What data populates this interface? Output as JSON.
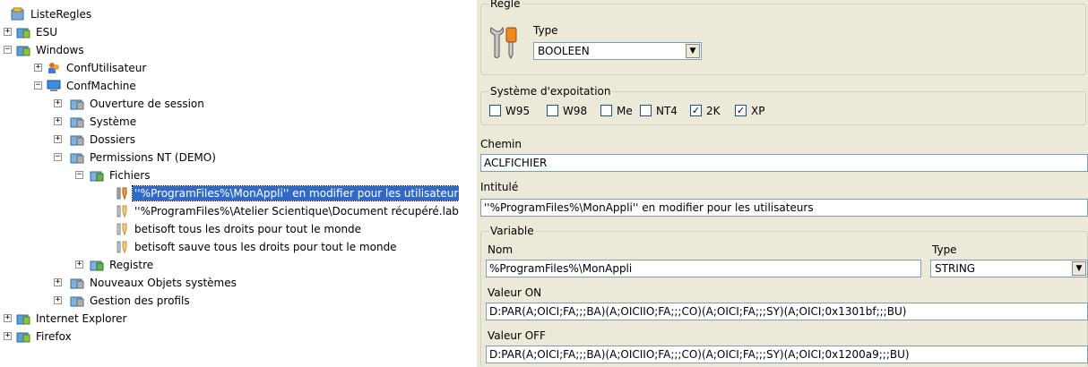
{
  "tree": {
    "root": "ListeRegles",
    "esu": "ESU",
    "windows": "Windows",
    "conf_utilisateur": "ConfUtilisateur",
    "conf_machine": "ConfMachine",
    "ouverture": "Ouverture de session",
    "systeme": "Système",
    "dossiers": "Dossiers",
    "permissions": "Permissions NT (DEMO)",
    "fichiers": "Fichiers",
    "rule1": "''%ProgramFiles%\\MonAppli'' en modifier pour les utilisateurs",
    "rule2": "''%ProgramFiles%\\Atelier Scientique\\Document récupéré.lab'' to",
    "rule3": "betisoft tous les droits pour tout le monde",
    "rule4": "betisoft sauve tous les droits pour tout le monde",
    "registre": "Registre",
    "nouveaux": "Nouveaux Objets systèmes",
    "gestion": "Gestion des profils",
    "ie": "Internet Explorer",
    "firefox": "Firefox"
  },
  "regle": {
    "legend": "Règle",
    "type_label": "Type",
    "type_value": "BOOLEEN"
  },
  "os": {
    "legend": "Système d'expoitation",
    "options": [
      {
        "label": "W95",
        "checked": false
      },
      {
        "label": "W98",
        "checked": false
      },
      {
        "label": "Me",
        "checked": false
      },
      {
        "label": "NT4",
        "checked": false
      },
      {
        "label": "2K",
        "checked": true
      },
      {
        "label": "XP",
        "checked": true
      }
    ]
  },
  "chemin": {
    "label": "Chemin",
    "value": "ACLFICHIER"
  },
  "intitule": {
    "label": "Intitulé",
    "value": "''%ProgramFiles%\\MonAppli'' en modifier pour les utilisateurs"
  },
  "variable": {
    "legend": "Variable",
    "nom_label": "Nom",
    "nom_value": "%ProgramFiles%\\MonAppli",
    "type_label": "Type",
    "type_value": "STRING",
    "on_label": "Valeur ON",
    "on_value": "D:PAR(A;OICI;FA;;;BA)(A;OICIIO;FA;;;CO)(A;OICI;FA;;;SY)(A;OICI;0x1301bf;;;BU)",
    "off_label": "Valeur OFF",
    "off_value": "D:PAR(A;OICI;FA;;;BA)(A;OICIIO;FA;;;CO)(A;OICI;FA;;;SY)(A;OICI;0x1200a9;;;BU)"
  }
}
